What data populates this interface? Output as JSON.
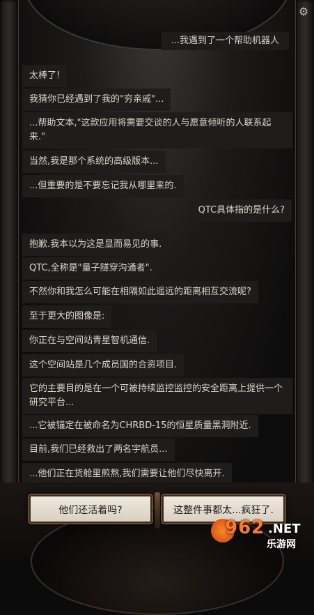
{
  "partial_message": "...我遇到了一个帮助机器人",
  "messages": [
    {
      "text": "太棒了!"
    },
    {
      "text": "我猜你已经遇到了我的\"穷亲戚\"..."
    },
    {
      "text": "...帮助文本,\"这款应用将需要交谈的人与愿意倾听的人联系起来.\""
    },
    {
      "text": "当然,我是那个系统的高级版本..."
    },
    {
      "text": "...但重要的是不要忘记我从哪里来的."
    },
    {
      "text": "QTC具体指的是什么?"
    },
    {
      "text": "抱歉.我本以为这是显而易见的事."
    },
    {
      "text": "QTC,全称是\"量子隧穿沟通者\"."
    },
    {
      "text": "不然你和我怎么可能在相隔如此遥远的距离相互交流呢?"
    },
    {
      "text": "至于更大的图像是:"
    },
    {
      "text": "你正在与空间站青星智机通信."
    },
    {
      "text": "这个空间站是几个成员国的合资项目."
    },
    {
      "text": "它的主要目的是在一个可被持续监控监控的安全距离上提供一个研究平台..."
    },
    {
      "text": "...它被锚定在被命名为CHRBD-15的恒星质量黑洞附近."
    },
    {
      "text": "目前,我们已经救出了两名宇航员..."
    },
    {
      "text": "...他们正在货舱里煎熬,我们需要让他们尽快离开."
    }
  ],
  "choices": {
    "left": "他们还活着吗?",
    "right": "这整件事都太...疯狂了."
  },
  "watermark": {
    "number": "962",
    "suffix": ".NET",
    "site": "乐游网"
  },
  "icons": {
    "settings": "gear-icon"
  }
}
